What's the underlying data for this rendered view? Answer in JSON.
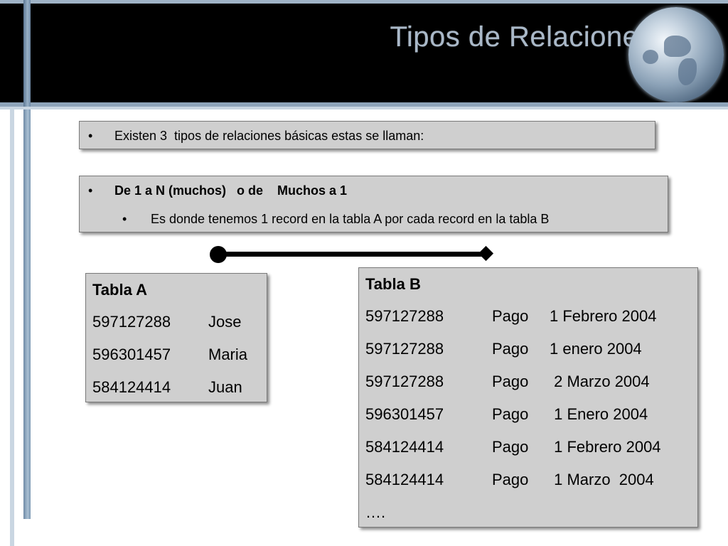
{
  "slide": {
    "title": "Tipos de Relaciones"
  },
  "intro": {
    "bullet": "•",
    "text": "Existen 3  tipos de relaciones básicas estas se llaman:"
  },
  "relation": {
    "bullet": "•",
    "title": "De 1 a N (muchos)   o de    Muchos a 1",
    "sub_bullet": "•",
    "description": "Es donde tenemos 1 record en la tabla A por cada record en la tabla B"
  },
  "table_a": {
    "title": "Tabla A",
    "rows": [
      {
        "id": "597127288",
        "name": "Jose"
      },
      {
        "id": "596301457",
        "name": "Maria"
      },
      {
        "id": "584124414",
        "name": "Juan"
      }
    ]
  },
  "table_b": {
    "title": "Tabla B",
    "rows": [
      {
        "id": "597127288",
        "concept": "Pago",
        "date": "1 Febrero 2004"
      },
      {
        "id": "597127288",
        "concept": "Pago",
        "date": "1 enero 2004"
      },
      {
        "id": "597127288",
        "concept": "Pago",
        "date": " 2 Marzo 2004"
      },
      {
        "id": "596301457",
        "concept": "Pago",
        "date": " 1 Enero 2004"
      },
      {
        "id": "584124414",
        "concept": "Pago",
        "date": " 1 Febrero 2004"
      },
      {
        "id": "584124414",
        "concept": "Pago",
        "date": " 1 Marzo  2004"
      }
    ],
    "ellipsis": "…."
  }
}
